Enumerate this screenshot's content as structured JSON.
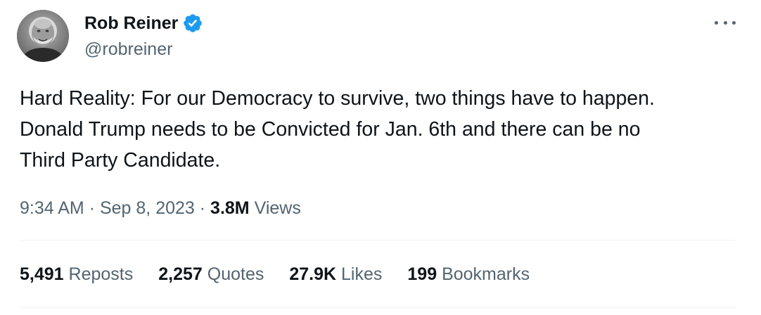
{
  "author": {
    "display_name": "Rob Reiner",
    "handle": "@robreiner",
    "verified": true,
    "avatar_icon": "profile-photo",
    "verified_icon": "verified-badge-icon"
  },
  "tweet": {
    "text": "Hard Reality: For our Democracy to survive, two things have to happen.\nDonald Trump needs to be Convicted for Jan. 6th and there can be no\nThird Party Candidate."
  },
  "meta": {
    "time": "9:34 AM",
    "separator": "·",
    "date": "Sep 8, 2023",
    "views_count": "3.8M",
    "views_label": "Views"
  },
  "stats": {
    "reposts_count": "5,491",
    "reposts_label": "Reposts",
    "quotes_count": "2,257",
    "quotes_label": "Quotes",
    "likes_count": "27.9K",
    "likes_label": "Likes",
    "bookmarks_count": "199",
    "bookmarks_label": "Bookmarks"
  },
  "colors": {
    "text_primary": "#0f1419",
    "text_secondary": "#536471",
    "verified_blue": "#1d9bf0",
    "divider": "#eff3f4"
  }
}
